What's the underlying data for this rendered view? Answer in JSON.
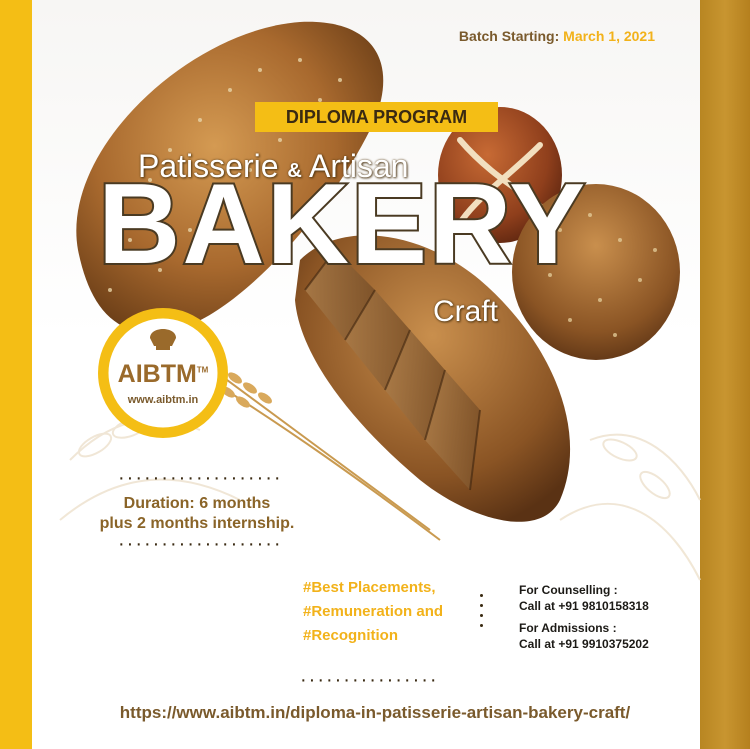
{
  "header": {
    "batch_label": "Batch Starting:",
    "batch_date": "March 1, 2021"
  },
  "title": {
    "badge": "DIPLOMA PROGRAM",
    "subtitle_left": "Patisserie",
    "subtitle_amp": "&",
    "subtitle_right": "Artisan",
    "headline": "BAKERY",
    "craft": "Craft"
  },
  "logo": {
    "name": "AIBTM",
    "tm": "TM",
    "url": "www.aibtm.in"
  },
  "duration": {
    "line1": "Duration: 6 months",
    "line2": "plus 2 months internship."
  },
  "highlights": [
    "#Best Placements,",
    "#Remuneration and",
    "#Recognition"
  ],
  "contacts": {
    "counselling_label": "For Counselling :",
    "counselling_phone": "Call at +91 9810158318",
    "admissions_label": "For Admissions :",
    "admissions_phone": "Call at +91 9910375202"
  },
  "footer": {
    "url": "https://www.aibtm.in/diploma-in-patisserie-artisan-bakery-craft/"
  },
  "colors": {
    "accent_yellow": "#f4be15",
    "gold": "#c89530",
    "brown_text": "#7a5a2c",
    "headline_stroke": "#4a3a22"
  }
}
